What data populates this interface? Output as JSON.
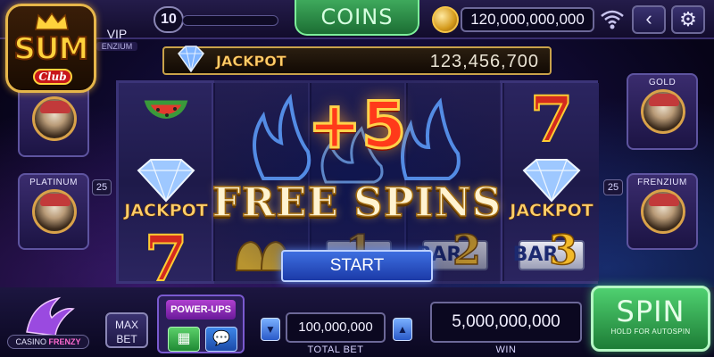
{
  "brand": {
    "logo_text": "SUM",
    "logo_sub": "Club",
    "vip_label": "VIP",
    "vip_sub": "ENZIUM"
  },
  "topbar": {
    "level": "10",
    "level_progress": 0.0,
    "coins_tab_label": "COINS",
    "balance": "120,000,000,000"
  },
  "jackpot": {
    "label": "JACKPOT",
    "value": "123,456,700"
  },
  "tiers": {
    "left": [
      {
        "label": "",
        "count": ""
      },
      {
        "label": "PLATINUM",
        "count": "25"
      }
    ],
    "right": [
      {
        "label": "GOLD",
        "count": ""
      },
      {
        "label": "FRENZIUM",
        "count": "25"
      }
    ]
  },
  "reel_symbols": {
    "seven": "7",
    "jackpot_label": "JACKPOT",
    "bar": "BAR",
    "two": "2",
    "three": "3",
    "one": "1"
  },
  "overlay": {
    "bonus_amount": "+5",
    "bonus_title": "FREE SPINS",
    "start_button": "START"
  },
  "bottombar": {
    "casino_name_1": "CASINO",
    "casino_name_2": "FRENZY",
    "max_bet_line1": "MAX",
    "max_bet_line2": "BET",
    "powerups_label": "POWER-UPS",
    "total_bet": "100,000,000",
    "total_bet_label": "TOTAL BET",
    "win": "5,000,000,000",
    "win_label": "WIN",
    "spin_label": "SPIN",
    "spin_sub": "HOLD FOR AUTOSPIN"
  },
  "colors": {
    "accent_green": "#3ea95c",
    "start_blue": "#2a55c8",
    "gold": "#ffcf6a",
    "seven_red": "#d42a1e"
  },
  "icons": {
    "wifi": "wifi-icon",
    "back": "chevron-left-icon",
    "settings": "gear-icon",
    "coin": "coin-icon",
    "grid": "grid-icon",
    "chat": "chat-bubble-icon",
    "arrow_down": "arrow-down-icon",
    "arrow_up": "arrow-up-icon"
  }
}
